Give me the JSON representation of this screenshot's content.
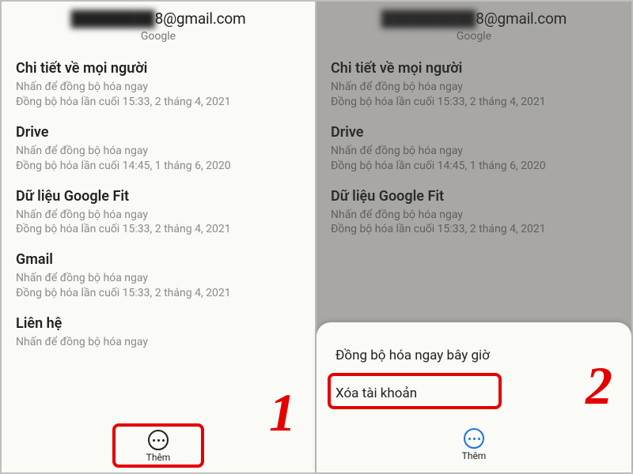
{
  "left": {
    "email_masked": "████████",
    "email_visible": "8@gmail.com",
    "provider": "Google",
    "items": [
      {
        "title": "Chi tiết về mọi người",
        "sub1": "Nhấn để đồng bộ hóa ngay",
        "sub2": "Đồng bộ hóa lần cuối 15:33, 2 tháng 4, 2021"
      },
      {
        "title": "Drive",
        "sub1": "Nhấn để đồng bộ hóa ngay",
        "sub2": "Đồng bộ hóa lần cuối 14:45, 1 tháng 6, 2020"
      },
      {
        "title": "Dữ liệu Google Fit",
        "sub1": "Nhấn để đồng bộ hóa ngay",
        "sub2": "Đồng bộ hóa lần cuối 15:33, 2 tháng 4, 2021"
      },
      {
        "title": "Gmail",
        "sub1": "Nhấn để đồng bộ hóa ngay",
        "sub2": "Đồng bộ hóa lần cuối 15:33, 2 tháng 4, 2021"
      },
      {
        "title": "Liên hệ",
        "sub1": "Nhấn để đồng bộ hóa ngay",
        "sub2": ""
      }
    ],
    "more_label": "Thêm",
    "step": "1"
  },
  "right": {
    "email_masked": "█████████",
    "email_visible": "8@gmail.com",
    "provider": "Google",
    "items": [
      {
        "title": "Chi tiết về mọi người",
        "sub1": "Nhấn để đồng bộ hóa ngay",
        "sub2": "Đồng bộ hóa lần cuối 15:33, 2 tháng 4, 2021"
      },
      {
        "title": "Drive",
        "sub1": "Nhấn để đồng bộ hóa ngay",
        "sub2": "Đồng bộ hóa lần cuối 14:45, 1 tháng 6, 2020"
      },
      {
        "title": "Dữ liệu Google Fit",
        "sub1": "Nhấn để đồng bộ hóa ngay",
        "sub2": "Đồng bộ hóa lần cuối 15:33, 2 tháng 4, 2021"
      }
    ],
    "sheet": {
      "sync_now": "Đồng bộ hóa ngay bây giờ",
      "remove": "Xóa tài khoản"
    },
    "more_label": "Thêm",
    "step": "2"
  }
}
